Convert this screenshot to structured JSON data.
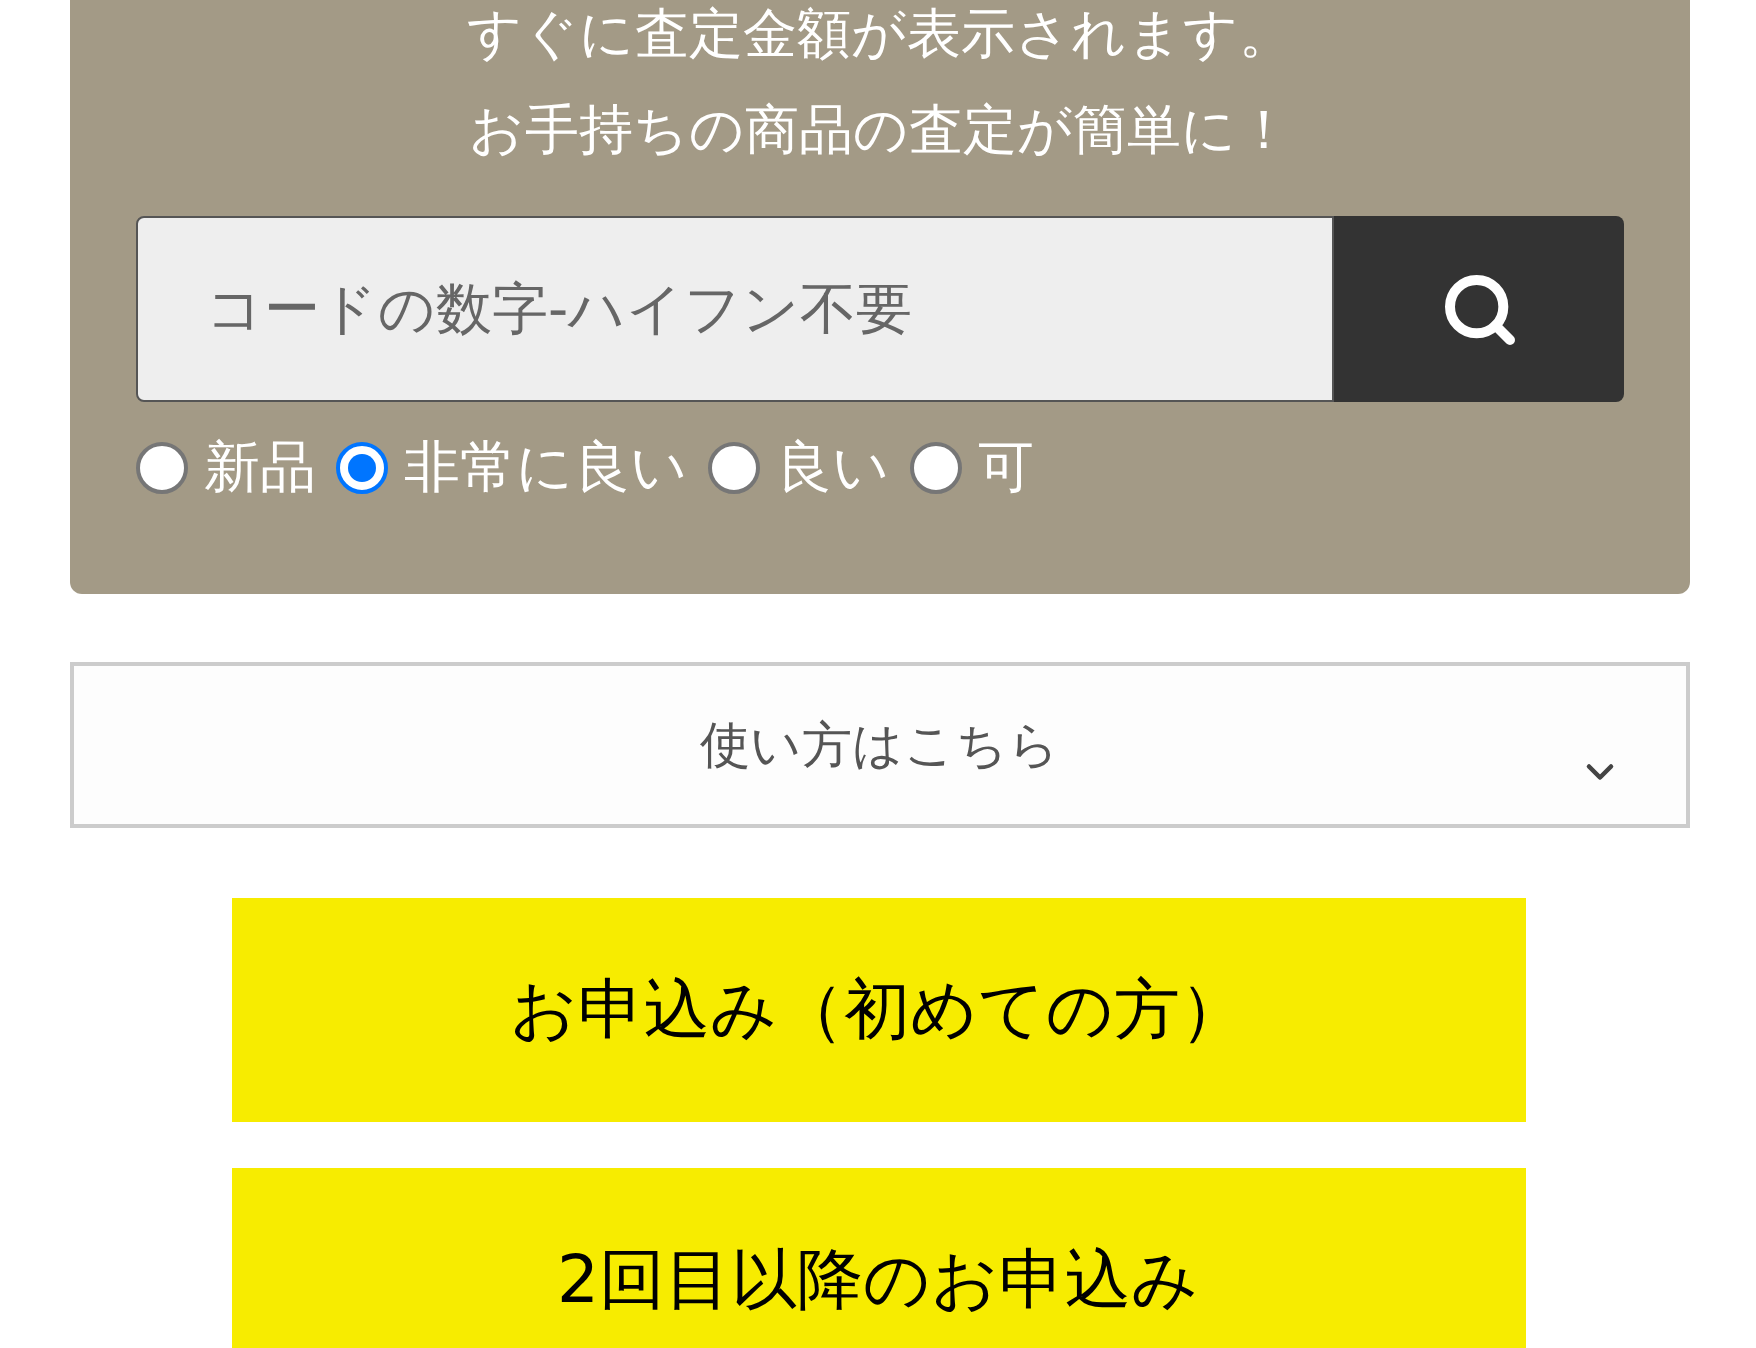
{
  "intro": [
    "すぐに査定金額が表示されます。",
    "お手持ちの商品の査定が簡単に！"
  ],
  "search": {
    "placeholder": "コードの数字-ハイフン不要"
  },
  "conditions": [
    {
      "label": "新品",
      "selected": false
    },
    {
      "label": "非常に良い",
      "selected": true
    },
    {
      "label": "良い",
      "selected": false
    },
    {
      "label": "可",
      "selected": false
    }
  ],
  "howto": {
    "label": "使い方はこちら",
    "expanded": false
  },
  "buttons": [
    "お申込み（初めての方）",
    "2回目以降のお申込み"
  ]
}
